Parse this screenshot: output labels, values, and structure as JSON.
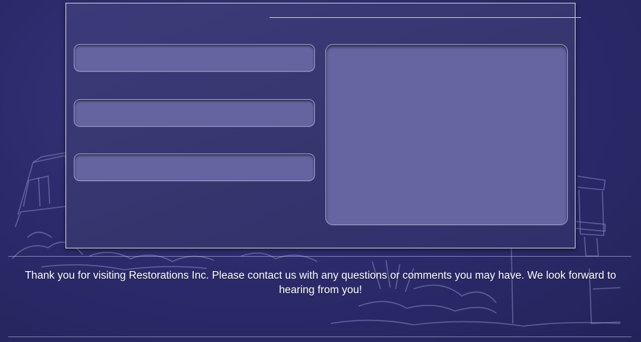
{
  "footer": {
    "message": "Thank you for visiting Restorations Inc. Please  contact us with any questions or comments you may have. We look forward to hearing from you!"
  },
  "colors": {
    "background": "#2c2c6e",
    "panel": "#36366f",
    "field": "#6464a0",
    "border": "#d4d4ea"
  },
  "form": {
    "fields": [
      "",
      "",
      ""
    ],
    "message": ""
  }
}
